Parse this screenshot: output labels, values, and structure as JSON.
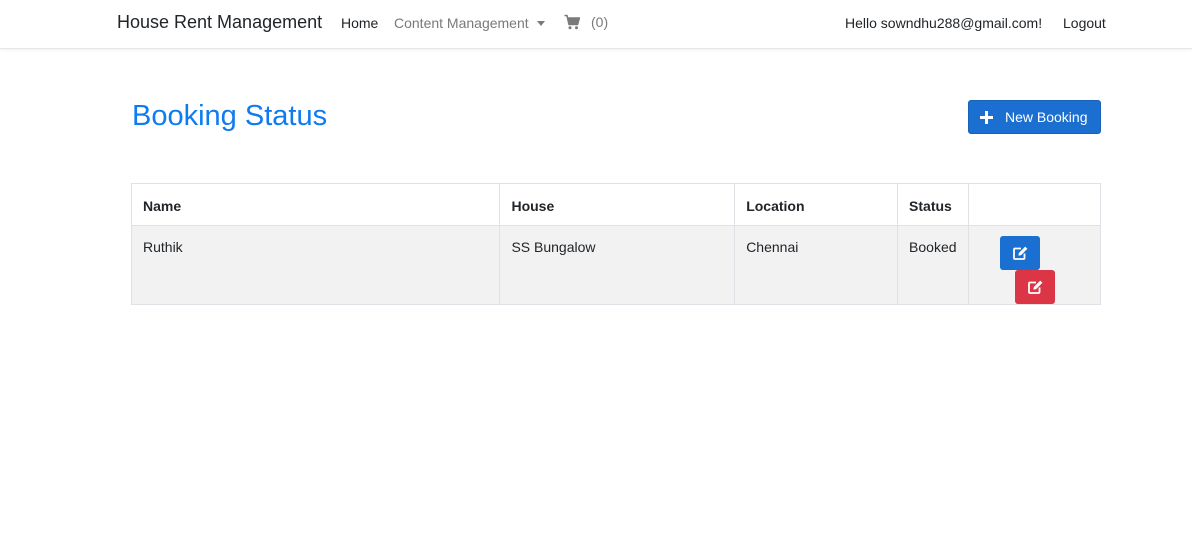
{
  "navbar": {
    "brand": "House Rent Management",
    "home": "Home",
    "content_management": "Content Management",
    "cart_count": "(0)",
    "greeting": "Hello sowndhu288@gmail.com!",
    "logout": "Logout"
  },
  "header": {
    "title": "Booking Status",
    "new_booking_label": "New Booking"
  },
  "table": {
    "columns": [
      "Name",
      "House",
      "Location",
      "Status",
      ""
    ],
    "rows": [
      {
        "name": "Ruthik",
        "house": "SS Bungalow",
        "location": "Chennai",
        "status": "Booked"
      }
    ]
  },
  "colors": {
    "accent": "#0d7bf2",
    "primary_button": "#1b6fd0",
    "danger_button": "#dc3545",
    "row_background": "#f2f2f2",
    "muted_text": "#7a7a7a"
  },
  "icons": {
    "cart": "shopping-cart-icon",
    "new_booking": "plus-icon",
    "edit": "edit-icon",
    "delete": "edit-icon"
  }
}
